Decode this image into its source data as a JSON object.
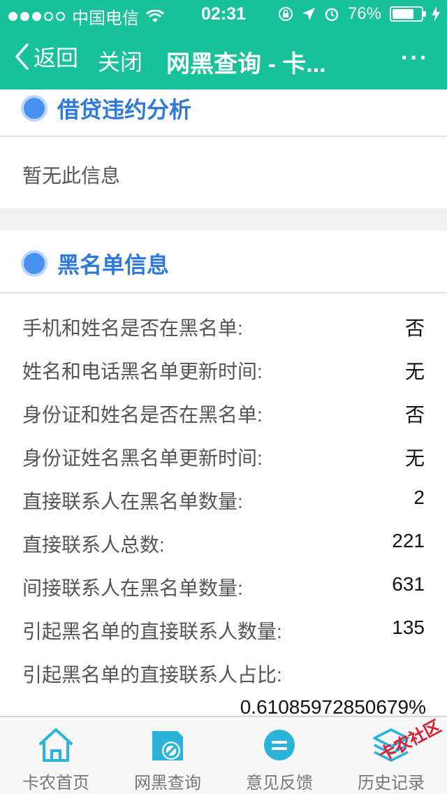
{
  "status_bar": {
    "carrier": "中国电信",
    "time": "02:31",
    "battery": "76%",
    "battery_level": 0.76
  },
  "nav": {
    "back_label": "返回",
    "close_label": "关闭",
    "title": "网黑查询 - 卡...",
    "more_label": "···"
  },
  "loan_default": {
    "title": "借贷违约分析",
    "empty_note": "暂无此信息"
  },
  "blacklist": {
    "title": "黑名单信息",
    "rows": [
      {
        "label": "手机和姓名是否在黑名单:",
        "value": "否"
      },
      {
        "label": "姓名和电话黑名单更新时间:",
        "value": "无"
      },
      {
        "label": "身份证和姓名是否在黑名单:",
        "value": "否"
      },
      {
        "label": "身份证姓名黑名单更新时间:",
        "value": "无"
      },
      {
        "label": "直接联系人在黑名单数量:",
        "value": "2"
      },
      {
        "label": "直接联系人总数:",
        "value": "221"
      },
      {
        "label": "间接联系人在黑名单数量:",
        "value": "631"
      },
      {
        "label": "引起黑名单的直接联系人数量:",
        "value": "135"
      },
      {
        "label": "引起黑名单的直接联系人占比:",
        "value": "0.61085972850679%"
      }
    ]
  },
  "tabs": [
    {
      "label": "卡农首页",
      "icon": "home-icon"
    },
    {
      "label": "网黑查询",
      "icon": "blacklist-query-icon"
    },
    {
      "label": "意见反馈",
      "icon": "feedback-icon"
    },
    {
      "label": "历史记录",
      "icon": "history-layers-icon"
    }
  ],
  "watermark": "卡农社区",
  "colors": {
    "header": "#17c19a",
    "accent_blue": "#2f7ad9",
    "tab_icon": "#2bb3d9",
    "watermark": "#e0192b"
  }
}
